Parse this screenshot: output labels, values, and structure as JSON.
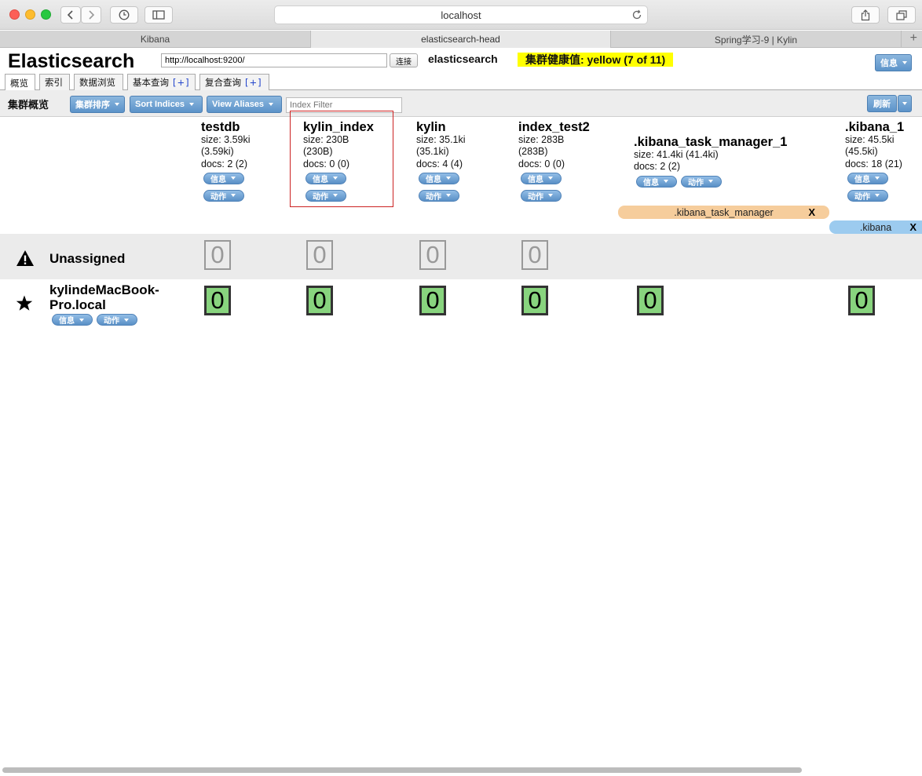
{
  "browser": {
    "url": "localhost",
    "tabs": [
      {
        "label": "Kibana"
      },
      {
        "label": "elasticsearch-head"
      },
      {
        "label": "Spring学习-9 | Kylin"
      }
    ],
    "new_tab_label": "+"
  },
  "header": {
    "title": "Elasticsearch",
    "url_value": "http://localhost:9200/",
    "connect_label": "连接",
    "cluster_name": "elasticsearch",
    "health_text": "集群健康值: yellow (7 of 11)",
    "health_color": "#ffff00",
    "info_label": "信息"
  },
  "app_tabs": [
    {
      "label": "概览"
    },
    {
      "label": "索引"
    },
    {
      "label": "数据浏览"
    },
    {
      "label": "基本查询",
      "plus": "[+]"
    },
    {
      "label": "复合查询",
      "plus": "[+]"
    }
  ],
  "toolbar": {
    "title": "集群概览",
    "sort_cluster_label": "集群排序",
    "sort_indices_label": "Sort Indices",
    "view_aliases_label": "View Aliases",
    "filter_placeholder": "Index Filter",
    "refresh_label": "刷新"
  },
  "indices": [
    {
      "name": "testdb",
      "size": "size: 3.59ki",
      "size2": "(3.59ki)",
      "docs": "docs: 2 (2)",
      "info": "信息",
      "action": "动作"
    },
    {
      "name": "kylin_index",
      "size": "size: 230B",
      "size2": "(230B)",
      "docs": "docs: 0 (0)",
      "info": "信息",
      "action": "动作"
    },
    {
      "name": "kylin",
      "size": "size: 35.1ki",
      "size2": "(35.1ki)",
      "docs": "docs: 4 (4)",
      "info": "信息",
      "action": "动作"
    },
    {
      "name": "index_test2",
      "size": "size: 283B",
      "size2": "(283B)",
      "docs": "docs: 0 (0)",
      "info": "信息",
      "action": "动作"
    },
    {
      "name": ".kibana_task_manager_1",
      "size": "size: 41.4ki (41.4ki)",
      "docs": "docs: 2 (2)",
      "info": "信息",
      "action": "动作"
    },
    {
      "name": ".kibana_1",
      "size": "size: 45.5ki",
      "size2": "(45.5ki)",
      "docs": "docs: 18 (21)",
      "info": "信息",
      "action": "动作"
    }
  ],
  "aliases": [
    {
      "name": ".kibana_task_manager",
      "remove": "X",
      "color": "#f6cd9c"
    },
    {
      "name": ".kibana",
      "remove": "X",
      "color": "#9ccbef"
    }
  ],
  "nodes": {
    "unassigned": {
      "name": "Unassigned",
      "shards": [
        "0",
        "0",
        "0",
        "0"
      ]
    },
    "local": {
      "name_line1": "kylindeMacBook-",
      "name_line2": "Pro.local",
      "info": "信息",
      "action": "动作",
      "shards": [
        "0",
        "0",
        "0",
        "0",
        "0",
        "0"
      ],
      "shard_color": "#88d47e"
    }
  }
}
